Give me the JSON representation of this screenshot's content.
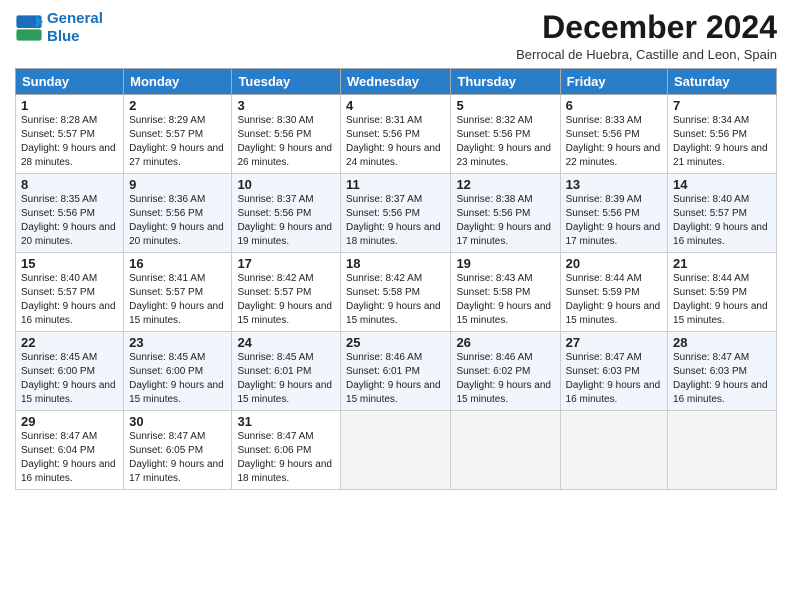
{
  "logo": {
    "line1": "General",
    "line2": "Blue",
    "icon": "▶"
  },
  "title": "December 2024",
  "subtitle": "Berrocal de Huebra, Castille and Leon, Spain",
  "headers": [
    "Sunday",
    "Monday",
    "Tuesday",
    "Wednesday",
    "Thursday",
    "Friday",
    "Saturday"
  ],
  "weeks": [
    [
      {
        "day": "1",
        "sunrise": "8:28 AM",
        "sunset": "5:57 PM",
        "daylight": "9 hours and 28 minutes."
      },
      {
        "day": "2",
        "sunrise": "8:29 AM",
        "sunset": "5:57 PM",
        "daylight": "9 hours and 27 minutes."
      },
      {
        "day": "3",
        "sunrise": "8:30 AM",
        "sunset": "5:56 PM",
        "daylight": "9 hours and 26 minutes."
      },
      {
        "day": "4",
        "sunrise": "8:31 AM",
        "sunset": "5:56 PM",
        "daylight": "9 hours and 24 minutes."
      },
      {
        "day": "5",
        "sunrise": "8:32 AM",
        "sunset": "5:56 PM",
        "daylight": "9 hours and 23 minutes."
      },
      {
        "day": "6",
        "sunrise": "8:33 AM",
        "sunset": "5:56 PM",
        "daylight": "9 hours and 22 minutes."
      },
      {
        "day": "7",
        "sunrise": "8:34 AM",
        "sunset": "5:56 PM",
        "daylight": "9 hours and 21 minutes."
      }
    ],
    [
      {
        "day": "8",
        "sunrise": "8:35 AM",
        "sunset": "5:56 PM",
        "daylight": "9 hours and 20 minutes."
      },
      {
        "day": "9",
        "sunrise": "8:36 AM",
        "sunset": "5:56 PM",
        "daylight": "9 hours and 20 minutes."
      },
      {
        "day": "10",
        "sunrise": "8:37 AM",
        "sunset": "5:56 PM",
        "daylight": "9 hours and 19 minutes."
      },
      {
        "day": "11",
        "sunrise": "8:37 AM",
        "sunset": "5:56 PM",
        "daylight": "9 hours and 18 minutes."
      },
      {
        "day": "12",
        "sunrise": "8:38 AM",
        "sunset": "5:56 PM",
        "daylight": "9 hours and 17 minutes."
      },
      {
        "day": "13",
        "sunrise": "8:39 AM",
        "sunset": "5:56 PM",
        "daylight": "9 hours and 17 minutes."
      },
      {
        "day": "14",
        "sunrise": "8:40 AM",
        "sunset": "5:57 PM",
        "daylight": "9 hours and 16 minutes."
      }
    ],
    [
      {
        "day": "15",
        "sunrise": "8:40 AM",
        "sunset": "5:57 PM",
        "daylight": "9 hours and 16 minutes."
      },
      {
        "day": "16",
        "sunrise": "8:41 AM",
        "sunset": "5:57 PM",
        "daylight": "9 hours and 15 minutes."
      },
      {
        "day": "17",
        "sunrise": "8:42 AM",
        "sunset": "5:57 PM",
        "daylight": "9 hours and 15 minutes."
      },
      {
        "day": "18",
        "sunrise": "8:42 AM",
        "sunset": "5:58 PM",
        "daylight": "9 hours and 15 minutes."
      },
      {
        "day": "19",
        "sunrise": "8:43 AM",
        "sunset": "5:58 PM",
        "daylight": "9 hours and 15 minutes."
      },
      {
        "day": "20",
        "sunrise": "8:44 AM",
        "sunset": "5:59 PM",
        "daylight": "9 hours and 15 minutes."
      },
      {
        "day": "21",
        "sunrise": "8:44 AM",
        "sunset": "5:59 PM",
        "daylight": "9 hours and 15 minutes."
      }
    ],
    [
      {
        "day": "22",
        "sunrise": "8:45 AM",
        "sunset": "6:00 PM",
        "daylight": "9 hours and 15 minutes."
      },
      {
        "day": "23",
        "sunrise": "8:45 AM",
        "sunset": "6:00 PM",
        "daylight": "9 hours and 15 minutes."
      },
      {
        "day": "24",
        "sunrise": "8:45 AM",
        "sunset": "6:01 PM",
        "daylight": "9 hours and 15 minutes."
      },
      {
        "day": "25",
        "sunrise": "8:46 AM",
        "sunset": "6:01 PM",
        "daylight": "9 hours and 15 minutes."
      },
      {
        "day": "26",
        "sunrise": "8:46 AM",
        "sunset": "6:02 PM",
        "daylight": "9 hours and 15 minutes."
      },
      {
        "day": "27",
        "sunrise": "8:47 AM",
        "sunset": "6:03 PM",
        "daylight": "9 hours and 16 minutes."
      },
      {
        "day": "28",
        "sunrise": "8:47 AM",
        "sunset": "6:03 PM",
        "daylight": "9 hours and 16 minutes."
      }
    ],
    [
      {
        "day": "29",
        "sunrise": "8:47 AM",
        "sunset": "6:04 PM",
        "daylight": "9 hours and 16 minutes."
      },
      {
        "day": "30",
        "sunrise": "8:47 AM",
        "sunset": "6:05 PM",
        "daylight": "9 hours and 17 minutes."
      },
      {
        "day": "31",
        "sunrise": "8:47 AM",
        "sunset": "6:06 PM",
        "daylight": "9 hours and 18 minutes."
      },
      null,
      null,
      null,
      null
    ]
  ]
}
